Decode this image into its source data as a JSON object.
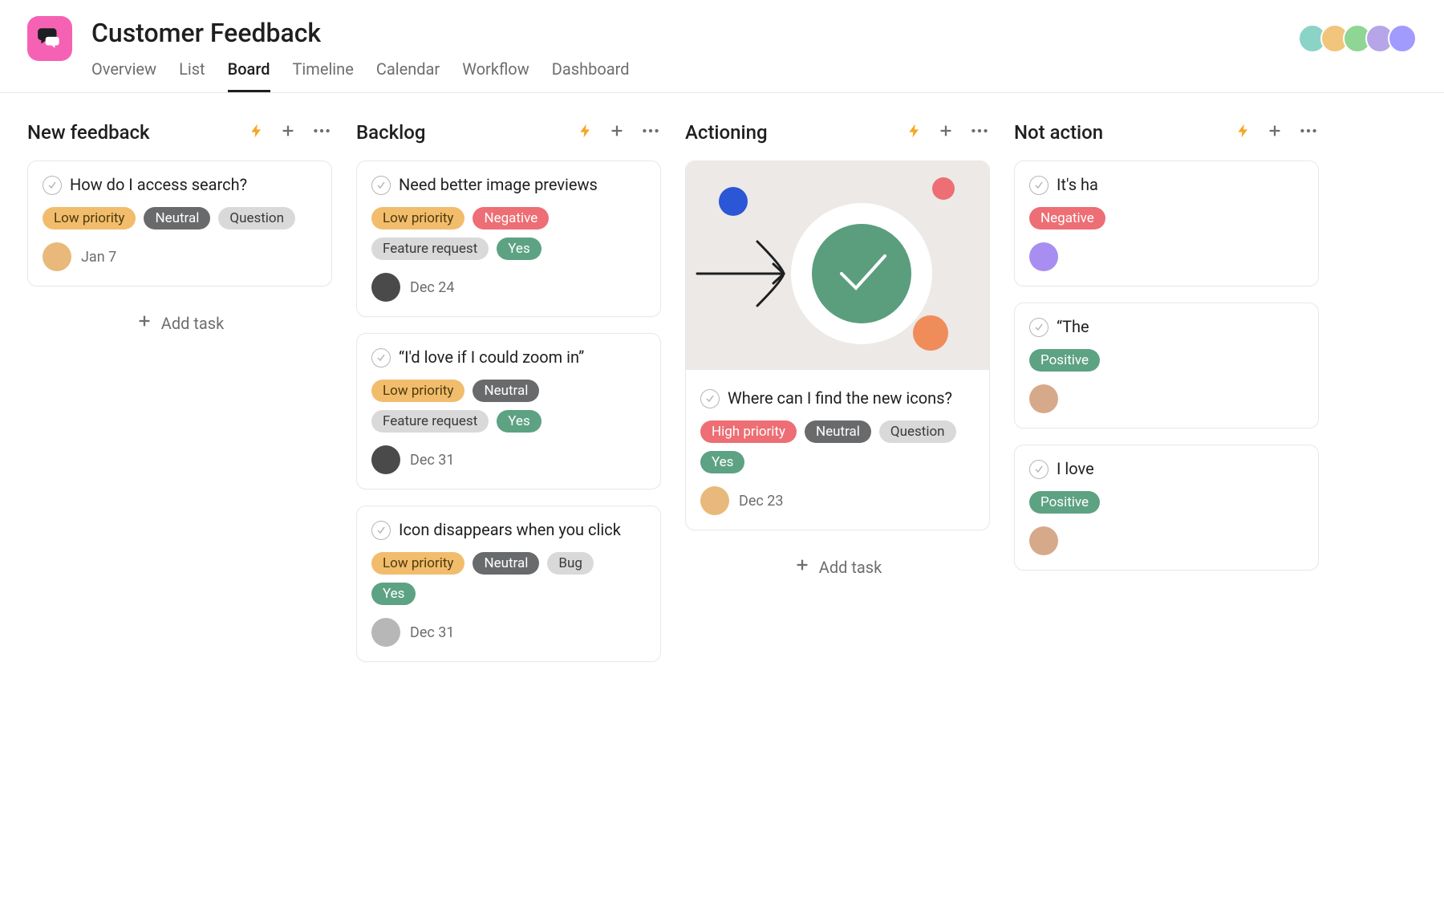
{
  "project": {
    "title": "Customer Feedback",
    "icon": "chat-bubbles-icon"
  },
  "tabs": [
    {
      "label": "Overview",
      "active": false
    },
    {
      "label": "List",
      "active": false
    },
    {
      "label": "Board",
      "active": true
    },
    {
      "label": "Timeline",
      "active": false
    },
    {
      "label": "Calendar",
      "active": false
    },
    {
      "label": "Workflow",
      "active": false
    },
    {
      "label": "Dashboard",
      "active": false
    }
  ],
  "members": [
    {
      "color": "#8cd3c7"
    },
    {
      "color": "#f2c57c"
    },
    {
      "color": "#8fd694"
    },
    {
      "color": "#b6a6e8"
    },
    {
      "color": "#a29bfe"
    }
  ],
  "labels": {
    "add_task": "Add task"
  },
  "tag_colors": {
    "Low priority": "amber",
    "High priority": "red",
    "Neutral": "gray",
    "Negative": "red",
    "Positive": "green",
    "Question": "lgray",
    "Feature request": "lgray",
    "Bug": "lgray",
    "Yes": "green"
  },
  "avatar_colors": {
    "user-a": "#e8b97a",
    "user-b": "#4a4a4a",
    "user-c": "#a88ef0",
    "user-d": "#d6a98a"
  },
  "columns": [
    {
      "title": "New feedback",
      "show_add_task": true,
      "cards": [
        {
          "title": "How do I access search?",
          "tags": [
            "Low priority",
            "Neutral",
            "Question"
          ],
          "assignee": "user-a",
          "date": "Jan 7",
          "has_cover": false
        }
      ]
    },
    {
      "title": "Backlog",
      "show_add_task": false,
      "cards": [
        {
          "title": "Need better image previews",
          "tags": [
            "Low priority",
            "Negative",
            "Feature request",
            "Yes"
          ],
          "assignee": "user-b",
          "date": "Dec 24",
          "has_cover": false
        },
        {
          "title": "“I'd love if I could zoom in”",
          "tags": [
            "Low priority",
            "Neutral",
            "Feature request",
            "Yes"
          ],
          "assignee": "user-b",
          "date": "Dec 31",
          "has_cover": false
        },
        {
          "title": "Icon disappears when you click",
          "tags": [
            "Low priority",
            "Neutral",
            "Bug",
            "Yes"
          ],
          "assignee": "user-b",
          "date": "Dec 31",
          "has_cover": false,
          "faded_avatar": true
        }
      ]
    },
    {
      "title": "Actioning",
      "show_add_task": true,
      "cards": [
        {
          "title": "Where can I find the new icons?",
          "tags": [
            "High priority",
            "Neutral",
            "Question",
            "Yes"
          ],
          "assignee": "user-a",
          "date": "Dec 23",
          "has_cover": true
        }
      ]
    },
    {
      "title": "Not action",
      "show_add_task": false,
      "cards": [
        {
          "title": "It's ha",
          "tags": [
            "Negative"
          ],
          "assignee": "user-c",
          "date": "",
          "has_cover": false
        },
        {
          "title": "“The",
          "tags": [
            "Positive"
          ],
          "assignee": "user-d",
          "date": "",
          "has_cover": false
        },
        {
          "title": "I love",
          "tags": [
            "Positive"
          ],
          "assignee": "user-d",
          "date": "",
          "has_cover": false
        }
      ]
    }
  ]
}
